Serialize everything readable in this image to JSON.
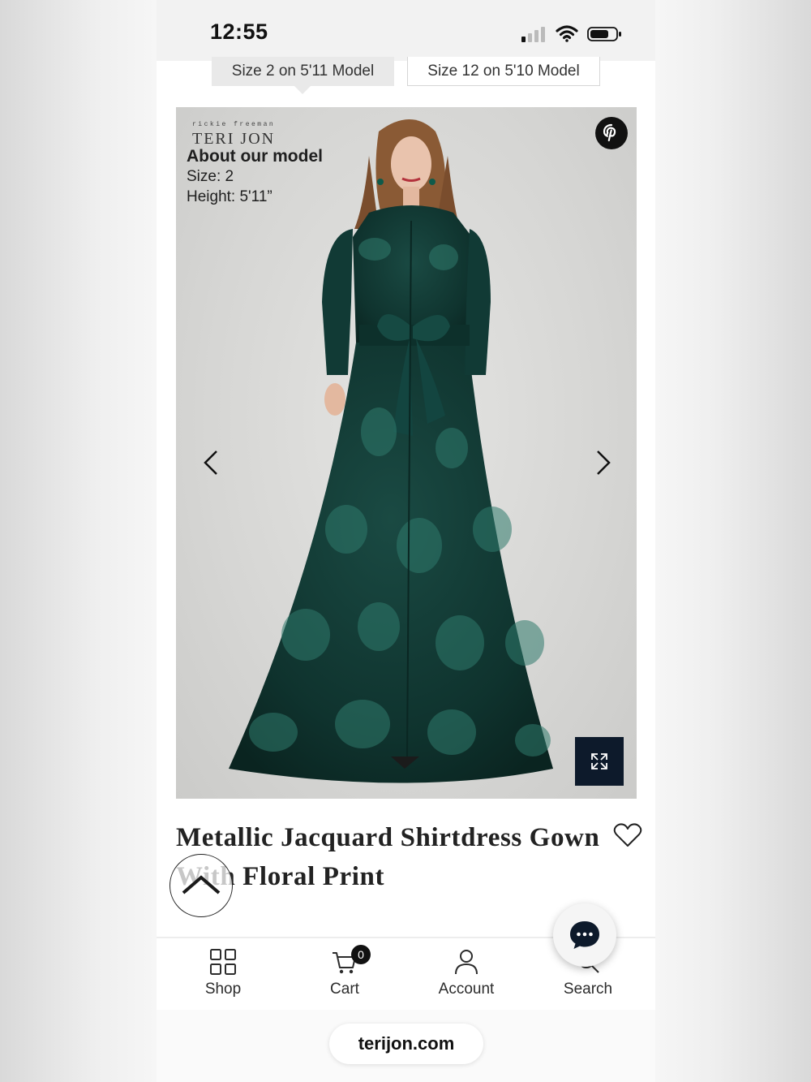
{
  "status_bar": {
    "time": "12:55"
  },
  "size_tabs": [
    {
      "label": "Size 2 on 5'11 Model",
      "active": true
    },
    {
      "label": "Size 12 on 5'10 Model",
      "active": false
    }
  ],
  "gallery": {
    "brand_small": "rickie freeman",
    "brand_name": "TERI JON",
    "model_info_title": "About our model",
    "model_size": "Size: 2",
    "model_height": "Height: 5'11”",
    "icons": {
      "pinterest": "pinterest-icon",
      "prev": "chevron-left-icon",
      "next": "chevron-right-icon",
      "expand": "expand-icon"
    },
    "dress_color": "#0f3b36"
  },
  "product": {
    "title_line1": "Metallic Jacquard Shirtdress Gown",
    "title_line2": "With Floral Print"
  },
  "tabbar": {
    "shop": "Shop",
    "cart": "Cart",
    "cart_count": "0",
    "account": "Account",
    "search": "Search"
  },
  "browser": {
    "url": "terijon.com"
  }
}
